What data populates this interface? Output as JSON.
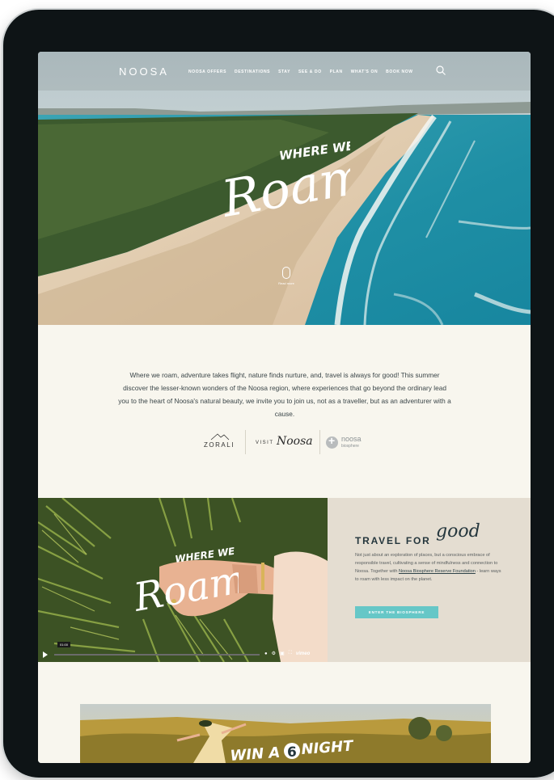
{
  "brand": {
    "logo": "NOOSA"
  },
  "nav": {
    "items": [
      "NOOSA OFFERS",
      "DESTINATIONS",
      "STAY",
      "SEE & DO",
      "PLAN",
      "WHAT'S ON",
      "BOOK NOW"
    ]
  },
  "hero": {
    "script_top": "WHERE WE",
    "script_main": "Roam",
    "scroll_label": "Read more"
  },
  "intro": {
    "text": "Where we roam, adventure takes flight, nature finds nurture, and, travel is always for good! This summer discover the lesser-known wonders of the Noosa region, where experiences that go beyond the ordinary lead you to the heart of Noosa's natural beauty, we invite you to join us, not as a traveller, but as an adventurer with a cause."
  },
  "partners": {
    "zorali": "ZORALI",
    "visit": "VISIT",
    "visit_script": "Noosa",
    "biosphere_top": "noosa",
    "biosphere_bottom": "biosphere"
  },
  "video": {
    "script_top": "WHERE WE",
    "script_main": "Roam",
    "timecode": "01:00",
    "progress": 0,
    "vimeo_label": "vimeo"
  },
  "travel": {
    "heading": "TRAVEL FOR",
    "script_word": "good",
    "body_start": "Not just about an exploration of places, but a conscious embrace of responsible travel, cultivating a sense of mindfulness and connection to Noosa. Together with ",
    "body_link": "Noosa Biosphere Reserve Foundation",
    "body_end": " - learn ways to roam with less impact on the planet.",
    "cta": "ENTER THE BIOSPHERE"
  },
  "banner": {
    "text_start": "WIN A",
    "number": "6",
    "text_end": "NIGHT"
  },
  "colors": {
    "page_bg": "#f8f6ee",
    "travel_bg": "#e4ddd1",
    "cta": "#66c7c7",
    "heading": "#24363d"
  }
}
